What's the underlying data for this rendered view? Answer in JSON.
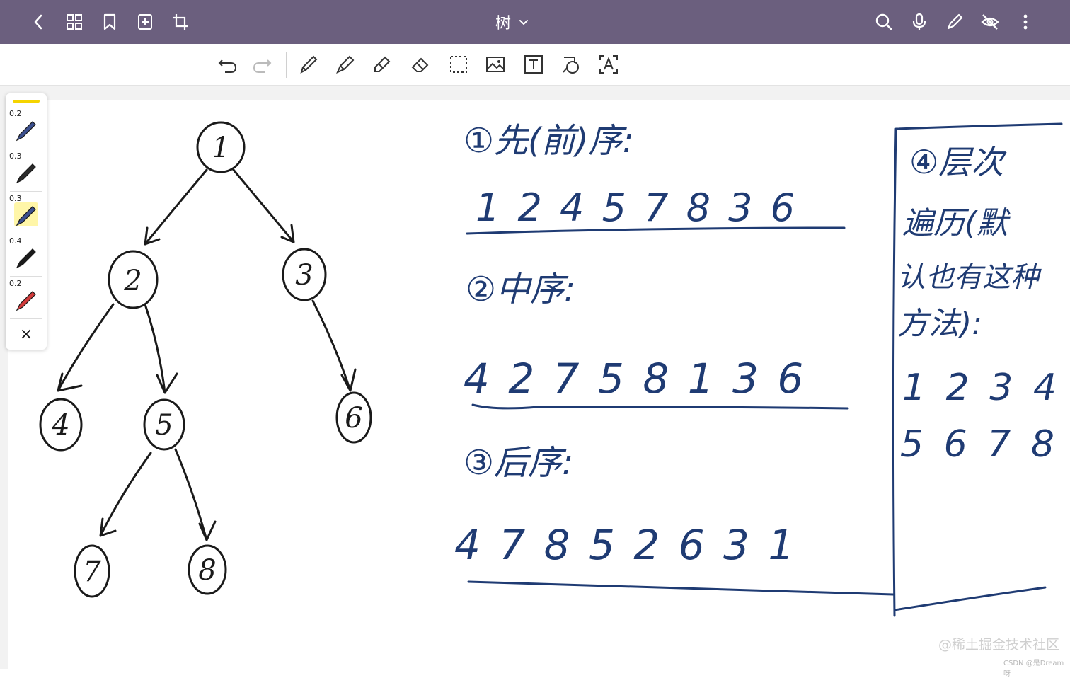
{
  "app": {
    "title": "树",
    "accent_color": "#6b5f7e"
  },
  "topbar": {
    "left_icons": [
      "back-icon",
      "grid-icon",
      "bookmark-icon",
      "add-page-icon",
      "crop-icon"
    ],
    "right_icons": [
      "search-icon",
      "microphone-icon",
      "pen-icon",
      "hide-icon",
      "more-icon"
    ]
  },
  "toolbar": {
    "tools": [
      "undo-icon",
      "redo-icon",
      "pencil-icon",
      "fountain-pen-icon",
      "highlighter-icon",
      "eraser-icon",
      "lasso-select-icon",
      "image-icon",
      "text-box-icon",
      "shape-icon",
      "ocr-text-icon"
    ]
  },
  "pen_panel": {
    "pens": [
      {
        "size": "0.2",
        "color": "#3b4f8f"
      },
      {
        "size": "0.3",
        "color": "#2a2a2a"
      },
      {
        "size": "0.3",
        "color": "#3b4f8f"
      },
      {
        "size": "0.4",
        "color": "#1a1a1a"
      },
      {
        "size": "0.2",
        "color": "#d23a3a"
      }
    ],
    "close_label": "×",
    "highlight_color": "#f5d400"
  },
  "canvas": {
    "ink_color": "#1f3b73",
    "tree_ink": "#1a1a1a",
    "tree_nodes": [
      "1",
      "2",
      "3",
      "4",
      "5",
      "6",
      "7",
      "8"
    ],
    "preorder_title": "①先(前)序:",
    "preorder_seq": "1 2 4 5 7 8 3 6",
    "inorder_title": "②中序:",
    "inorder_seq": "4 2 7 5 8 1 3 6",
    "postorder_title": "③后序:",
    "postorder_seq": "4 7 8 5 2 6 3 1",
    "level_title_1": "④层次",
    "level_title_2": "遍历(默",
    "level_title_3": "认也有这种",
    "level_title_4": "方法):",
    "level_seq_1": "1 2 3 4",
    "level_seq_2": "5 6 7 8"
  },
  "watermark": {
    "main": "@稀土掘金技术社区",
    "sub": "CSDN @是Dream呀"
  }
}
